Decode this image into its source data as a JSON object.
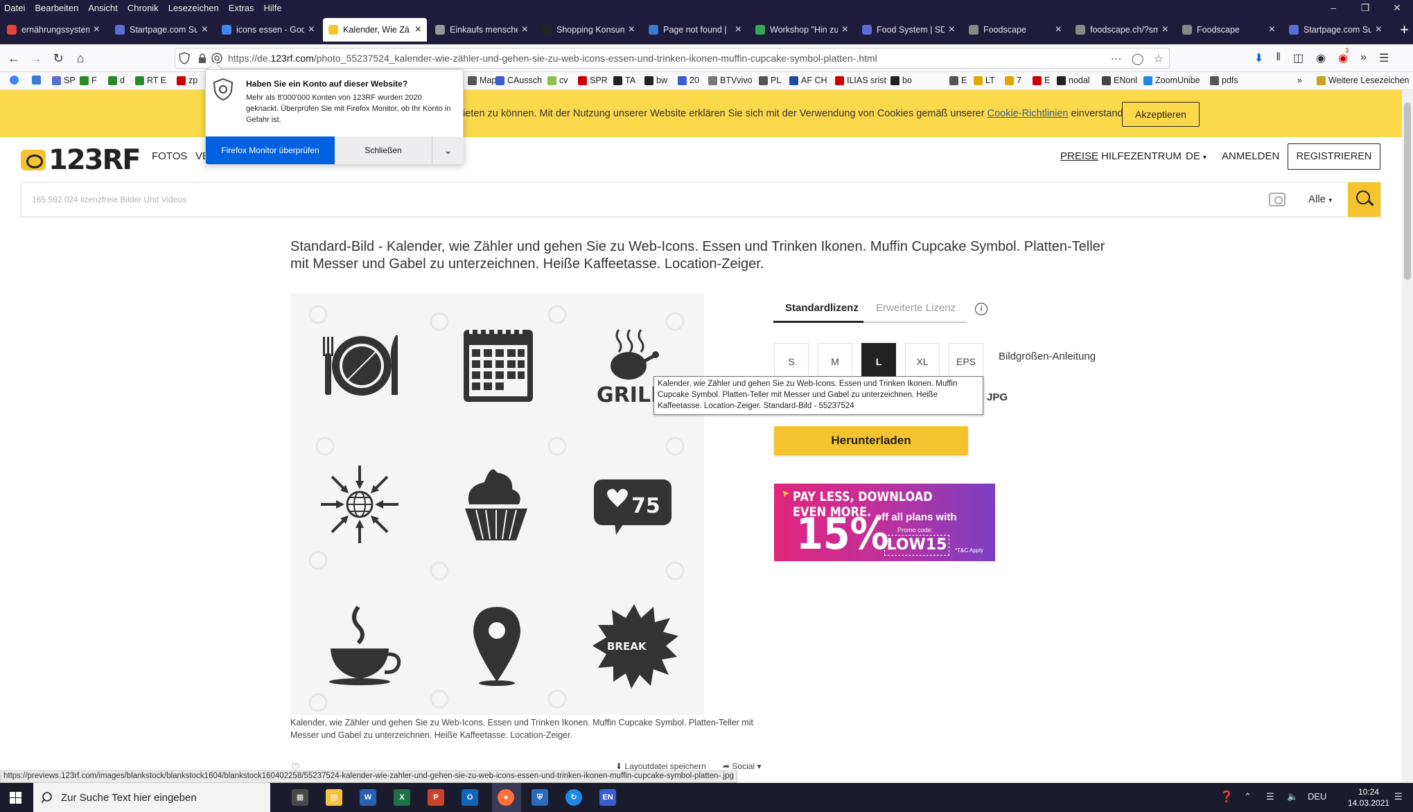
{
  "menu": [
    "Datei",
    "Bearbeiten",
    "Ansicht",
    "Chronik",
    "Lesezeichen",
    "Extras",
    "Hilfe"
  ],
  "tabs": [
    {
      "label": "ernährungssystem",
      "color": "#ea4335"
    },
    {
      "label": "Startpage.com Su",
      "color": "#5a6fd6"
    },
    {
      "label": "icons essen - Goo",
      "color": "#4285f4"
    },
    {
      "label": "Kalender, Wie Zä",
      "color": "#f4c430",
      "active": true
    },
    {
      "label": "Einkaufs mensche",
      "color": "#999999"
    },
    {
      "label": "Shopping Konsum",
      "color": "#222222"
    },
    {
      "label": "Page not found |",
      "color": "#3a7bd5"
    },
    {
      "label": "Workshop \"Hin zu",
      "color": "#34a853"
    },
    {
      "label": "Food System | SD",
      "color": "#5a6fd6"
    },
    {
      "label": "Foodscape",
      "color": "#888888"
    },
    {
      "label": "foodscape.ch/?smd_p",
      "color": "#888888"
    },
    {
      "label": "Foodscape",
      "color": "#888888"
    },
    {
      "label": "Startpage.com Su",
      "color": "#5a6fd6"
    }
  ],
  "url": {
    "prefix": "https://de.",
    "domain": "123rf.com",
    "path": "/photo_55237524_kalender-wie-zähler-und-gehen-sie-zu-web-icons-essen-und-trinken-ikonen-muffin-cupcake-symbol-platten-.html"
  },
  "bookmarks": [
    "SP",
    "F",
    "d",
    "RT E",
    "zp",
    "Map",
    "CAussch",
    "cv",
    "SPR",
    "TA",
    "bw",
    "20",
    "BTVvivo",
    "PL",
    "AF CH",
    "ILIAS srist",
    "bo",
    "E",
    "LT",
    "7",
    "E",
    "nodal",
    "ENonl",
    "ZoomUnibe",
    "pdfs",
    "Weitere Lesezeichen"
  ],
  "cookie": {
    "text": "bieten zu können. Mit der Nutzung unserer Website erklären Sie sich mit der Verwendung von Cookies gemäß unserer",
    "link": "Cookie-Richtlinien",
    "text_end": "einverstanden.",
    "accept": "Akzeptieren"
  },
  "header": {
    "logo": "123RF",
    "nav_fotos": "FOTOS",
    "nav_ve": "VE",
    "preise": "PREISE",
    "hilfe": "HILFEZENTRUM",
    "lang": "DE",
    "anmelden": "ANMELDEN",
    "register": "REGISTRIEREN"
  },
  "search": {
    "placeholder": "165.592.024  lizenzfreie Bilder Und Videos",
    "filter": "Alle"
  },
  "page_title": "Standard-Bild - Kalender, wie Zähler und gehen Sie zu Web-Icons. Essen und Trinken Ikonen. Muffin Cupcake Symbol. Platten-Teller mit Messer und Gabel zu unterzeichnen. Heiße Kaffeetasse. Location-Zeiger.",
  "caption": "Kalender, wie Zähler und gehen Sie zu Web-Icons. Essen und Trinken Ikonen. Muffin Cupcake Symbol. Platten-Teller mit Messer und Gabel zu unterzeichnen. Heiße Kaffeetasse. Location-Zeiger.",
  "image_labels": {
    "grill": "GRILL",
    "likes": "75",
    "break": "BREAK"
  },
  "below_image": {
    "save": "Layoutdatei speichern",
    "social": "Social"
  },
  "license": {
    "standard": "Standardlizenz",
    "extended": "Erweiterte Lizenz",
    "sizes": [
      "S",
      "M",
      "L",
      "XL",
      "EPS"
    ],
    "selected_size": "L",
    "size_guide": "Bildgrößen-Anleitung",
    "format": "JPG",
    "download": "Herunterladen"
  },
  "promo": {
    "headline": "PAY LESS, DOWNLOAD EVEN MORE.",
    "percent": "15%",
    "off_text": "off all plans with",
    "promo_label": "Promo code:",
    "code": "LOW15",
    "tc": "*T&C Apply"
  },
  "tooltip": "Kalender, wie Zähler und gehen Sie zu Web-Icons. Essen und Trinken Ikonen. Muffin Cupcake Symbol. Platten-Teller mit Messer und Gabel zu unterzeichnen. Heiße Kaffeetasse. Location-Zeiger. Standard-Bild - 55237524",
  "firefox_popup": {
    "title": "Haben Sie ein Konto auf dieser Website?",
    "body": "Mehr als 8'000'000 Konten von 123RF wurden 2020 geknackt. Überprüfen Sie mit Firefox Monitor, ob Ihr Konto in Gefahr ist.",
    "primary": "Firefox Monitor überprüfen",
    "secondary": "Schließen"
  },
  "status_url": "https://previews.123rf.com/images/blankstock/blankstock1604/blankstock160402258/55237524-kalender-wie-zahler-und-gehen-sie-zu-web-icons-essen-und-trinken-ikonen-muffin-cupcake-symbol-platten-.jpg",
  "taskbar": {
    "search": "Zur Suche Text hier eingeben",
    "lang": "DEU",
    "time": "10:24",
    "date": "14.03.2021"
  },
  "addon_badge": "3"
}
